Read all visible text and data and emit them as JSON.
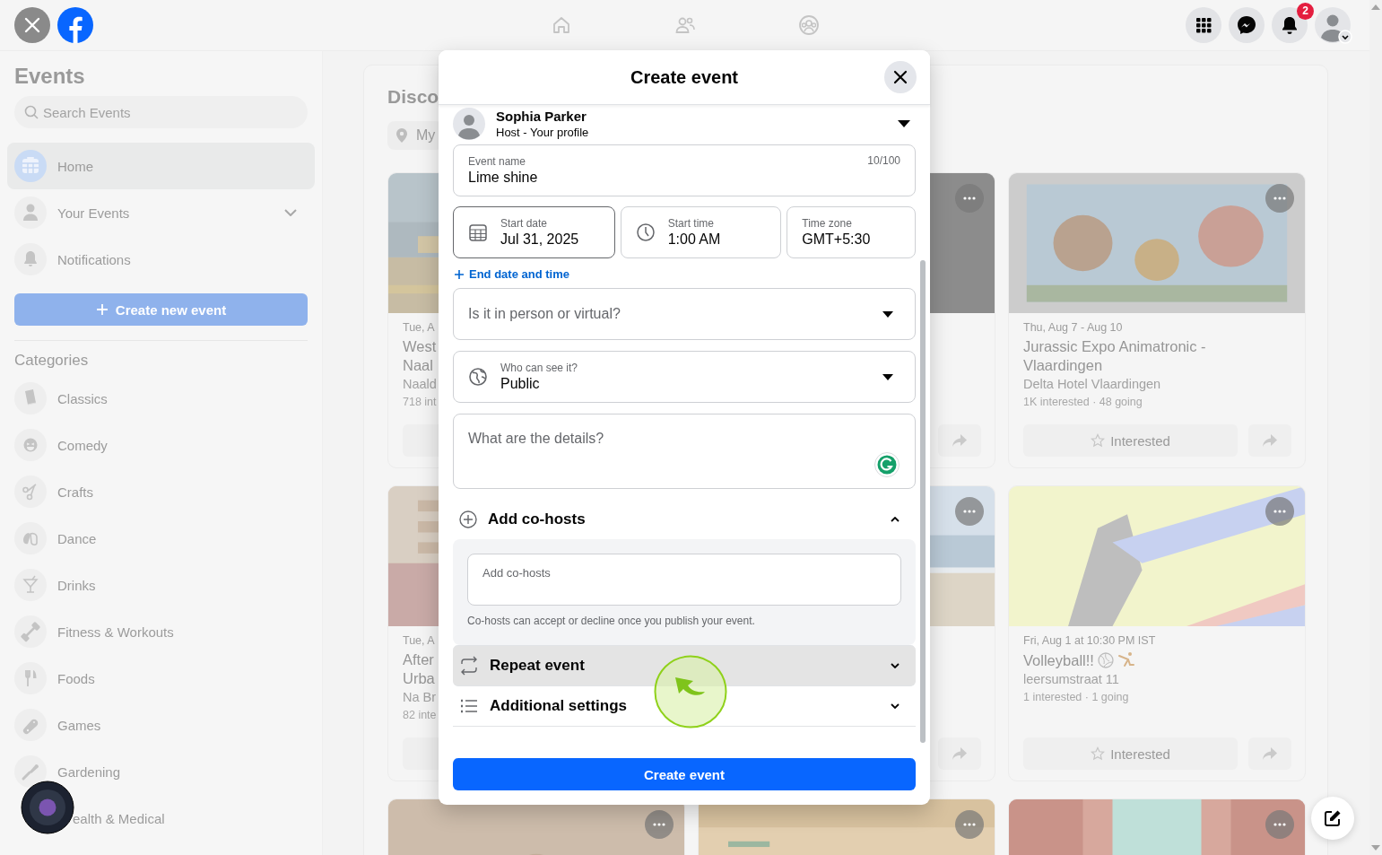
{
  "top_bar": {
    "notification_count": "2"
  },
  "sidebar": {
    "title": "Events",
    "search_placeholder": "Search Events",
    "nav": [
      {
        "label": "Home",
        "selected": true,
        "expandable": false
      },
      {
        "label": "Your Events",
        "selected": false,
        "expandable": true
      },
      {
        "label": "Notifications",
        "selected": false,
        "expandable": false
      }
    ],
    "create_button": "Create new event",
    "categories_title": "Categories",
    "categories": [
      "Classics",
      "Comedy",
      "Crafts",
      "Dance",
      "Drinks",
      "Fitness & Workouts",
      "Foods",
      "Games",
      "Gardening",
      "ealth & Medical"
    ]
  },
  "discover": {
    "title": "Disco",
    "location_chip": "My",
    "cards": [
      {
        "more_button": false,
        "date": "Tue, A",
        "title_lines": [
          "West",
          "Naal"
        ],
        "location": "Naald",
        "stats": "718 int",
        "buttons": [
          {
            "kind": "interested"
          }
        ]
      },
      {
        "more_button": true,
        "buttons": [
          {
            "kind": "share"
          }
        ]
      },
      {
        "more_button": true,
        "date": "Thu, Aug 7 - Aug 10",
        "title_lines": [
          "Jurassic Expo Animatronic -",
          "Vlaardingen"
        ],
        "location": "Delta Hotel Vlaardingen",
        "stats": "1K interested · 48 going",
        "buttons": [
          {
            "kind": "interested",
            "label": "Interested"
          },
          {
            "kind": "share"
          }
        ]
      },
      {
        "more_button": false,
        "date": "Tue, A",
        "title_lines": [
          "After",
          "Urba"
        ],
        "location": "Na Br",
        "stats": "82 inte",
        "buttons": [
          {
            "kind": "interested"
          }
        ]
      },
      {
        "more_button": true,
        "buttons": [
          {
            "kind": "share"
          }
        ]
      },
      {
        "more_button": true,
        "date": "Fri, Aug 1 at 10:30 PM IST",
        "title_lines": [
          "Volleyball!!"
        ],
        "title_emoji": true,
        "location": "leersumstraat 11",
        "stats": "1 interested · 1 going",
        "buttons": [
          {
            "kind": "interested",
            "label": "Interested"
          },
          {
            "kind": "share"
          }
        ]
      },
      {
        "more_button": true
      },
      {
        "more_button": true
      },
      {
        "more_button": true
      }
    ]
  },
  "modal": {
    "title": "Create event",
    "host": {
      "name": "Sophia Parker",
      "role": "Host - Your profile"
    },
    "event_name": {
      "label": "Event name",
      "value": "Lime shine",
      "counter": "10/100"
    },
    "datetime_fields": [
      {
        "kind": "date",
        "label": "Start date",
        "value": "Jul 31, 2025",
        "focused": true
      },
      {
        "kind": "time",
        "label": "Start time",
        "value": "1:00 AM",
        "focused": false
      },
      {
        "kind": "zone",
        "label": "Time zone",
        "value": "GMT+5:30",
        "focused": false
      }
    ],
    "end_date_link": "End date and time",
    "location_select": {
      "prompt": "Is it in person or virtual?"
    },
    "privacy_select": {
      "label": "Who can see it?",
      "value": "Public"
    },
    "details": {
      "placeholder": "What are the details?"
    },
    "cohosts": {
      "title": "Add co-hosts",
      "expanded": true,
      "placeholder": "Add co-hosts",
      "help": "Co-hosts can accept or decline once you publish your event."
    },
    "sections": [
      {
        "kind": "repeat",
        "title": "Repeat event",
        "hovered": true
      },
      {
        "kind": "settings",
        "title": "Additional settings",
        "hovered": false
      }
    ],
    "submit": "Create event"
  }
}
